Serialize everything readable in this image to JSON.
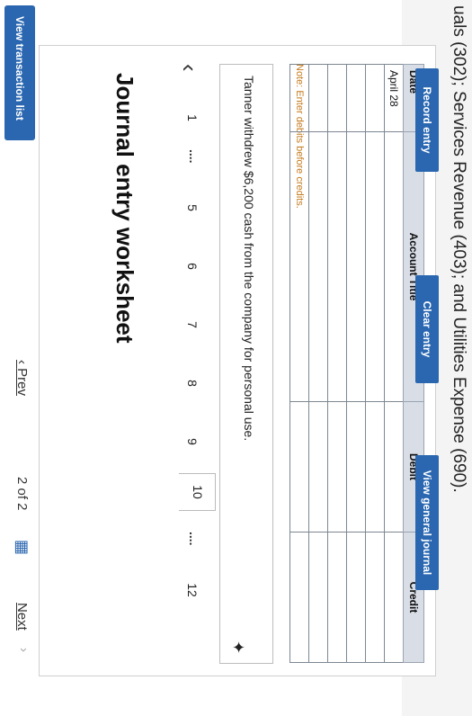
{
  "header": {
    "partial_text": "uals (302); Services Revenue (403); and Utilities Expense (690)."
  },
  "buttons": {
    "view_transactions": "View transaction list",
    "record_entry": "Record entry",
    "clear_entry": "Clear entry",
    "view_general_journal": "View general journal"
  },
  "worksheet": {
    "title": "Journal entry worksheet",
    "pager": {
      "first": "1",
      "dots": "....",
      "pages": [
        "5",
        "6",
        "7",
        "8",
        "9",
        "10"
      ],
      "active": "10",
      "last": "12"
    },
    "transaction": "Tanner withdrew $6,200 cash from the company for personal use.",
    "note": "Note: Enter debits before credits.",
    "table": {
      "headers": {
        "date": "Date",
        "account": "Account Title",
        "debit": "Debit",
        "credit": "Credit"
      },
      "rows": [
        {
          "date": "April 28",
          "account": "",
          "debit": "",
          "credit": ""
        },
        {
          "date": "",
          "account": "",
          "debit": "",
          "credit": ""
        },
        {
          "date": "",
          "account": "",
          "debit": "",
          "credit": ""
        },
        {
          "date": "",
          "account": "",
          "debit": "",
          "credit": ""
        },
        {
          "date": "",
          "account": "",
          "debit": "",
          "credit": ""
        },
        {
          "date": "",
          "account": "",
          "debit": "",
          "credit": ""
        }
      ]
    }
  },
  "navigation": {
    "prev": "Prev",
    "page_of": "2 of 2",
    "next": "Next"
  }
}
